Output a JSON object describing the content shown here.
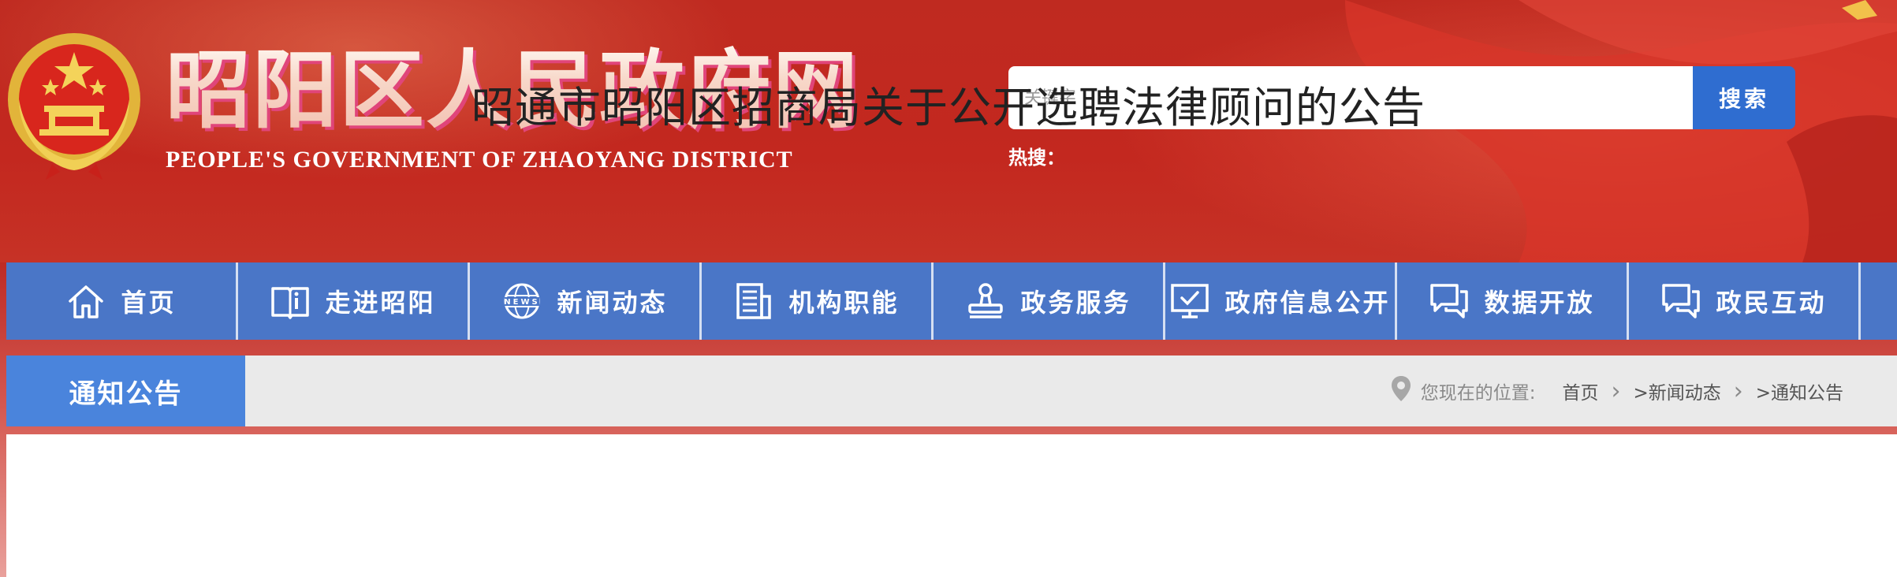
{
  "header": {
    "site_title": "昭阳区人民政府网",
    "site_subtitle": "PEOPLE'S GOVERNMENT OF ZHAOYANG DISTRICT",
    "search": {
      "placeholder": "关键字",
      "button_label": "搜索",
      "hot_label": "热搜："
    },
    "emblem_icon": "national-emblem-icon",
    "colors": {
      "banner_red": "#c3281f",
      "search_blue": "#2f6dd0"
    }
  },
  "nav": {
    "items": [
      {
        "label": "首页",
        "icon": "home-icon"
      },
      {
        "label": "走进昭阳",
        "icon": "book-icon"
      },
      {
        "label": "新闻动态",
        "icon": "news-globe-icon"
      },
      {
        "label": "机构职能",
        "icon": "building-doc-icon"
      },
      {
        "label": "政务服务",
        "icon": "stamp-icon"
      },
      {
        "label": "政府信息公开",
        "icon": "monitor-check-icon"
      },
      {
        "label": "数据开放",
        "icon": "chat-bubbles-icon"
      },
      {
        "label": "政民互动",
        "icon": "chat-bubbles-icon"
      }
    ],
    "colors": {
      "bg": "#4a76c7"
    }
  },
  "breadcrumb": {
    "section_title": "通知公告",
    "location_label": "您现在的位置:",
    "links": [
      "首页",
      ">新闻动态",
      ">通知公告"
    ],
    "icon": "location-pin-icon"
  },
  "article": {
    "title": "昭通市昭阳区招商局关于公开选聘法律顾问的公告"
  }
}
